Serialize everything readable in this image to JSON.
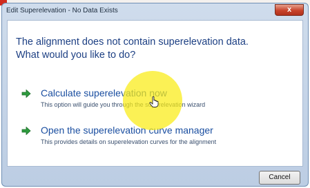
{
  "dialog": {
    "title": "Edit Superelevation - No Data Exists",
    "close_label": "x",
    "question_line1": "The alignment does not contain superelevation data.",
    "question_line2": "What would you like to do?",
    "options": [
      {
        "label": "Calculate superelevation now",
        "description": "This option will guide you through the superelevation wizard"
      },
      {
        "label": "Open the superelevation curve manager",
        "description": "This provides details on superelevation curves for the alignment"
      }
    ],
    "cancel_label": "Cancel"
  },
  "colors": {
    "command_link": "#1a4ea0",
    "arrow": "#2e9b3e",
    "highlight": "#faec14",
    "close_button": "#c8432b"
  },
  "icons": {
    "option_arrow": "green-arrow-icon",
    "cursor": "hand-cursor-icon"
  }
}
